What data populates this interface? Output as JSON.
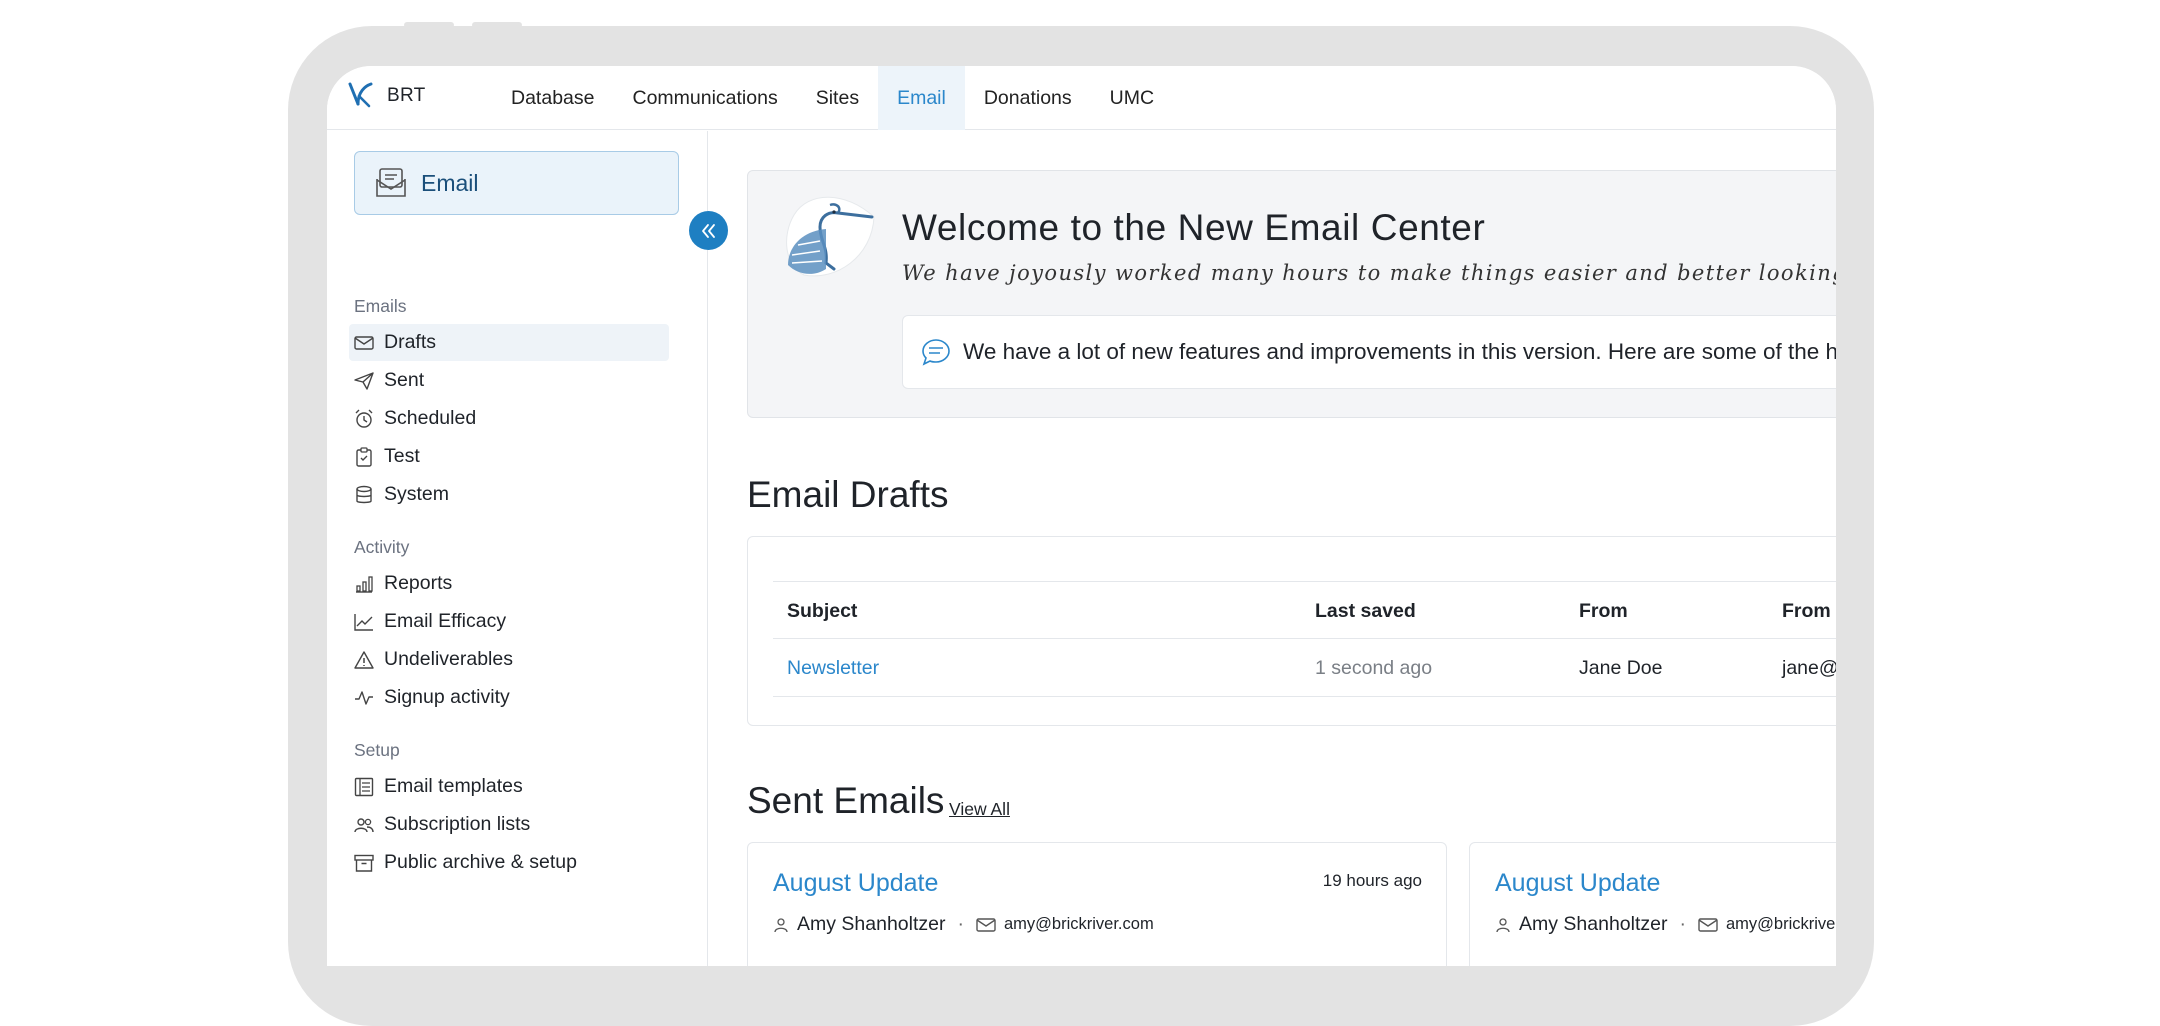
{
  "brand": {
    "name": "BRT"
  },
  "nav": {
    "items": [
      {
        "label": "Database",
        "active": false
      },
      {
        "label": "Communications",
        "active": false
      },
      {
        "label": "Sites",
        "active": false
      },
      {
        "label": "Email",
        "active": true
      },
      {
        "label": "Donations",
        "active": false
      },
      {
        "label": "UMC",
        "active": false
      }
    ]
  },
  "sidebar": {
    "header": "Email",
    "sections": [
      {
        "label": "Emails",
        "items": [
          {
            "label": "Drafts",
            "icon": "envelope-icon",
            "active": true
          },
          {
            "label": "Sent",
            "icon": "paper-plane-icon"
          },
          {
            "label": "Scheduled",
            "icon": "alarm-clock-icon"
          },
          {
            "label": "Test",
            "icon": "clipboard-check-icon"
          },
          {
            "label": "System",
            "icon": "database-icon"
          }
        ]
      },
      {
        "label": "Activity",
        "items": [
          {
            "label": "Reports",
            "icon": "bar-chart-icon"
          },
          {
            "label": "Email Efficacy",
            "icon": "line-chart-icon"
          },
          {
            "label": "Undeliverables",
            "icon": "warning-triangle-icon"
          },
          {
            "label": "Signup activity",
            "icon": "activity-pulse-icon"
          }
        ]
      },
      {
        "label": "Setup",
        "items": [
          {
            "label": "Email templates",
            "icon": "template-icon"
          },
          {
            "label": "Subscription lists",
            "icon": "users-icon"
          },
          {
            "label": "Public archive & setup",
            "icon": "archive-box-icon"
          }
        ]
      }
    ]
  },
  "welcome": {
    "title": "Welcome to the New Email Center",
    "subtitle": "We have joyously worked many hours to make things easier and better looking for you and those you",
    "note": "We have a lot of new features and improvements in this version. Here are some of the high"
  },
  "drafts": {
    "heading": "Email Drafts",
    "columns": [
      "Subject",
      "Last saved",
      "From",
      "From e"
    ],
    "rows": [
      {
        "subject": "Newsletter",
        "last_saved": "1 second ago",
        "from": "Jane Doe",
        "from_email": "jane@l"
      }
    ]
  },
  "sent": {
    "heading": "Sent Emails",
    "view_all": "View All",
    "cards": [
      {
        "title": "August Update",
        "time": "19 hours ago",
        "sender": "Amy Shanholtzer",
        "email": "amy@brickriver.com"
      },
      {
        "title": "August Update",
        "time": "",
        "sender": "Amy Shanholtzer",
        "email": "amy@brickriver."
      }
    ]
  },
  "colors": {
    "accent": "#2b87cb",
    "collapse_button": "#1e7fc2",
    "active_nav_bg": "#edf4fa"
  }
}
